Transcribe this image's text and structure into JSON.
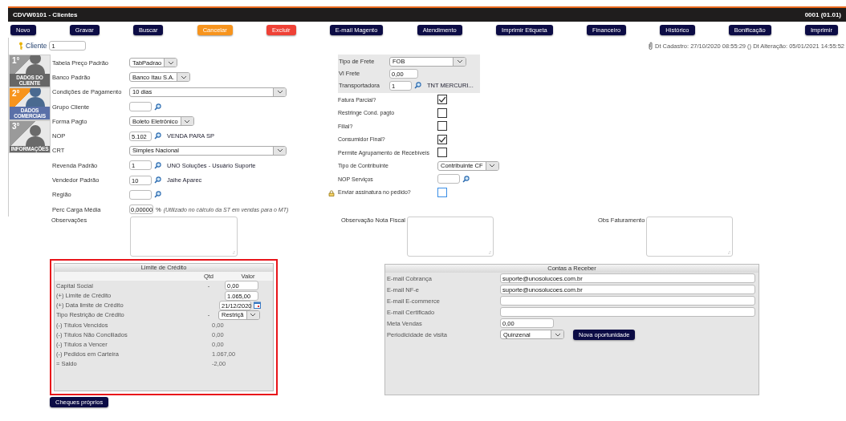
{
  "window": {
    "title": "CDVW0101 - Clientes",
    "company": "0001 (01.01)"
  },
  "toolbar": [
    {
      "label": "Novo",
      "kind": "default"
    },
    {
      "label": "Gravar",
      "kind": "default"
    },
    {
      "label": "Buscar",
      "kind": "default"
    },
    {
      "label": "Cancelar",
      "kind": "cancel"
    },
    {
      "label": "Excluir",
      "kind": "delete"
    },
    {
      "label": "E-mail Magento",
      "kind": "default"
    },
    {
      "label": "Atendimento",
      "kind": "default"
    },
    {
      "label": "Imprimir Etiqueta",
      "kind": "default"
    },
    {
      "label": "Financeiro",
      "kind": "default"
    },
    {
      "label": "Histórico",
      "kind": "default"
    },
    {
      "label": "Bonificação",
      "kind": "default"
    },
    {
      "label": "Imprimir",
      "kind": "default"
    }
  ],
  "cliente": {
    "label": "Cliente",
    "value": "1"
  },
  "audit": "Dt Cadastro: 27/10/2020 08:55:29 () Dt Alteração: 05/01/2021 14:55:52",
  "steps": [
    {
      "number": "1°",
      "label": "DADOS DO CLIENTE",
      "selected": false
    },
    {
      "number": "2°",
      "label": "DADOS COMERCIAIS",
      "selected": true
    },
    {
      "number": "3°",
      "label": "INFORMAÇÕES",
      "selected": false
    }
  ],
  "left_fields": [
    {
      "label": "Tabela Preço Padrão",
      "kind": "select",
      "value": "TabPadrao"
    },
    {
      "label": "Banco Padrão",
      "kind": "select",
      "value": "Banco Itau S.A."
    },
    {
      "label": "Condições de Pagamento",
      "kind": "wide_select",
      "value": "10 dias"
    },
    {
      "label": "Grupo Cliente",
      "kind": "lookup"
    },
    {
      "label": "Forma Pagto",
      "kind": "select",
      "value": "Boleto Eletrônico"
    },
    {
      "label": "NOP",
      "kind": "lookup",
      "value": "5.102",
      "description": "VENDA PARA SP"
    },
    {
      "label": "CRT",
      "kind": "wide_select",
      "value": "Simples Nacional"
    },
    {
      "label": "Revenda Padrão",
      "kind": "lookup",
      "value": "1",
      "description": "UNO Soluções - Usuário Suporte"
    },
    {
      "label": "Vendedor Padrão",
      "kind": "lookup",
      "value": "10",
      "description": "Jaihe Aparec"
    },
    {
      "label": "Região",
      "kind": "lookup"
    },
    {
      "label": "Perc Carga Média",
      "kind": "percent",
      "value": "0,00000",
      "unit": "%",
      "note": "(Utilizado no cálculo da ST em vendas para o MT)"
    }
  ],
  "freight": [
    {
      "label": "Tipo de Frete",
      "kind": "select",
      "value": "FOB"
    },
    {
      "label": "Vl Frete",
      "kind": "text",
      "value": "0,00"
    },
    {
      "label": "Transportadora",
      "kind": "lookup",
      "value": "1",
      "description": "TNT MERCURI..."
    }
  ],
  "options": [
    {
      "label": "Fatura Parcial?",
      "kind": "check",
      "checked": true
    },
    {
      "label": "Restringe Cond. pagto",
      "kind": "check",
      "checked": false
    },
    {
      "label": "Filial?",
      "kind": "check",
      "checked": false
    },
    {
      "label": "Consumidor Final?",
      "kind": "check",
      "checked": true
    },
    {
      "label": "Permite Agrupamento de Recebíveis",
      "kind": "check",
      "checked": false
    },
    {
      "label": "Tipo de Contribuinte",
      "kind": "select",
      "value": "Contribuinte CF"
    },
    {
      "label": "NOP Serviços",
      "kind": "lookup"
    },
    {
      "label": "Enviar assinatura no pedido?",
      "kind": "flagged_check",
      "checked": false
    }
  ],
  "notes": [
    {
      "label": "Observações"
    },
    {
      "label": "Observação Nota Fiscal"
    },
    {
      "label": "Obs Faturamento"
    }
  ],
  "credit": {
    "title": "Limite de Crédito",
    "highlighted": true,
    "columns": [
      "Qtd",
      "Valor"
    ],
    "rows": [
      {
        "label": "Capital Social",
        "qty": "-",
        "kind": "input",
        "value": "0,00"
      },
      {
        "label": "(+) Limite de Crédito",
        "kind": "input",
        "value": "1.065,00"
      },
      {
        "label": "(+) Data limite de Crédito",
        "kind": "date",
        "value": "21/12/2020"
      },
      {
        "label": "Tipo Restrição de Crédito",
        "qty": "-",
        "kind": "select",
        "value": "Restriçã"
      },
      {
        "label": "(-) Títulos Vencidos",
        "kind": "value",
        "value": "0,00"
      },
      {
        "label": "(-) Títulos Não Conciliados",
        "kind": "value",
        "value": "0,00"
      },
      {
        "label": "(-) Títulos a Vencer",
        "kind": "value",
        "value": "0,00"
      },
      {
        "label": "(-) Pedidos em Carteira",
        "kind": "value",
        "value": "1.067,00"
      },
      {
        "label": "= Saldo",
        "kind": "value",
        "value": "-2,00"
      }
    ]
  },
  "receivables": {
    "title": "Contas a Receber",
    "rows": [
      {
        "label": "E-mail Cobrança",
        "kind": "wide_input",
        "value": "suporte@unosolucoes.com.br"
      },
      {
        "label": "E-mail NF-e",
        "kind": "wide_input",
        "value": "suporte@unosolucoes.com.br"
      },
      {
        "label": "E-mail E-commerce",
        "kind": "wide_input"
      },
      {
        "label": "E-mail Certificado",
        "kind": "wide_input"
      },
      {
        "label": "Meta Vendas",
        "kind": "input",
        "value": "0,00"
      },
      {
        "label": "Periodicidade de visita",
        "kind": "select_action",
        "value": "Quinzenal",
        "action": "Nova oportunidade"
      }
    ]
  },
  "cheques_button": "Cheques próprios"
}
